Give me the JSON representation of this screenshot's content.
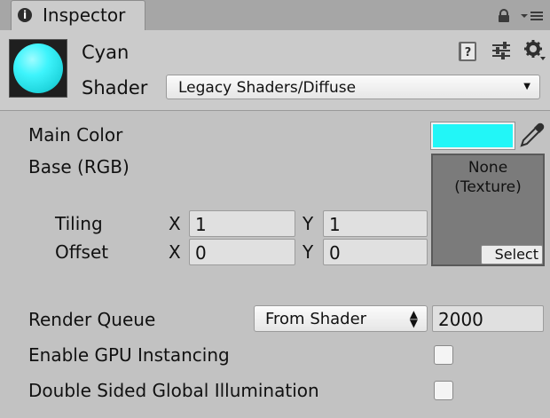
{
  "tab": {
    "title": "Inspector",
    "icon": "info-icon"
  },
  "header": {
    "material_name": "Cyan",
    "shader_label": "Shader",
    "shader_value": "Legacy Shaders/Diffuse",
    "preview_color": "#3ef4fc"
  },
  "properties": {
    "main_color_label": "Main Color",
    "main_color_value": "#22f6f7",
    "base_label": "Base (RGB)",
    "texture_text_line1": "None",
    "texture_text_line2": "(Texture)",
    "select_label": "Select",
    "tiling_label": "Tiling",
    "offset_label": "Offset",
    "x_label": "X",
    "y_label": "Y",
    "tiling_x": "1",
    "tiling_y": "1",
    "offset_x": "0",
    "offset_y": "0"
  },
  "render": {
    "queue_label": "Render Queue",
    "queue_dropdown": "From Shader",
    "queue_value": "2000",
    "gpu_instancing_label": "Enable GPU Instancing",
    "gpu_instancing_checked": false,
    "double_sided_gi_label": "Double Sided Global Illumination",
    "double_sided_gi_checked": false
  }
}
